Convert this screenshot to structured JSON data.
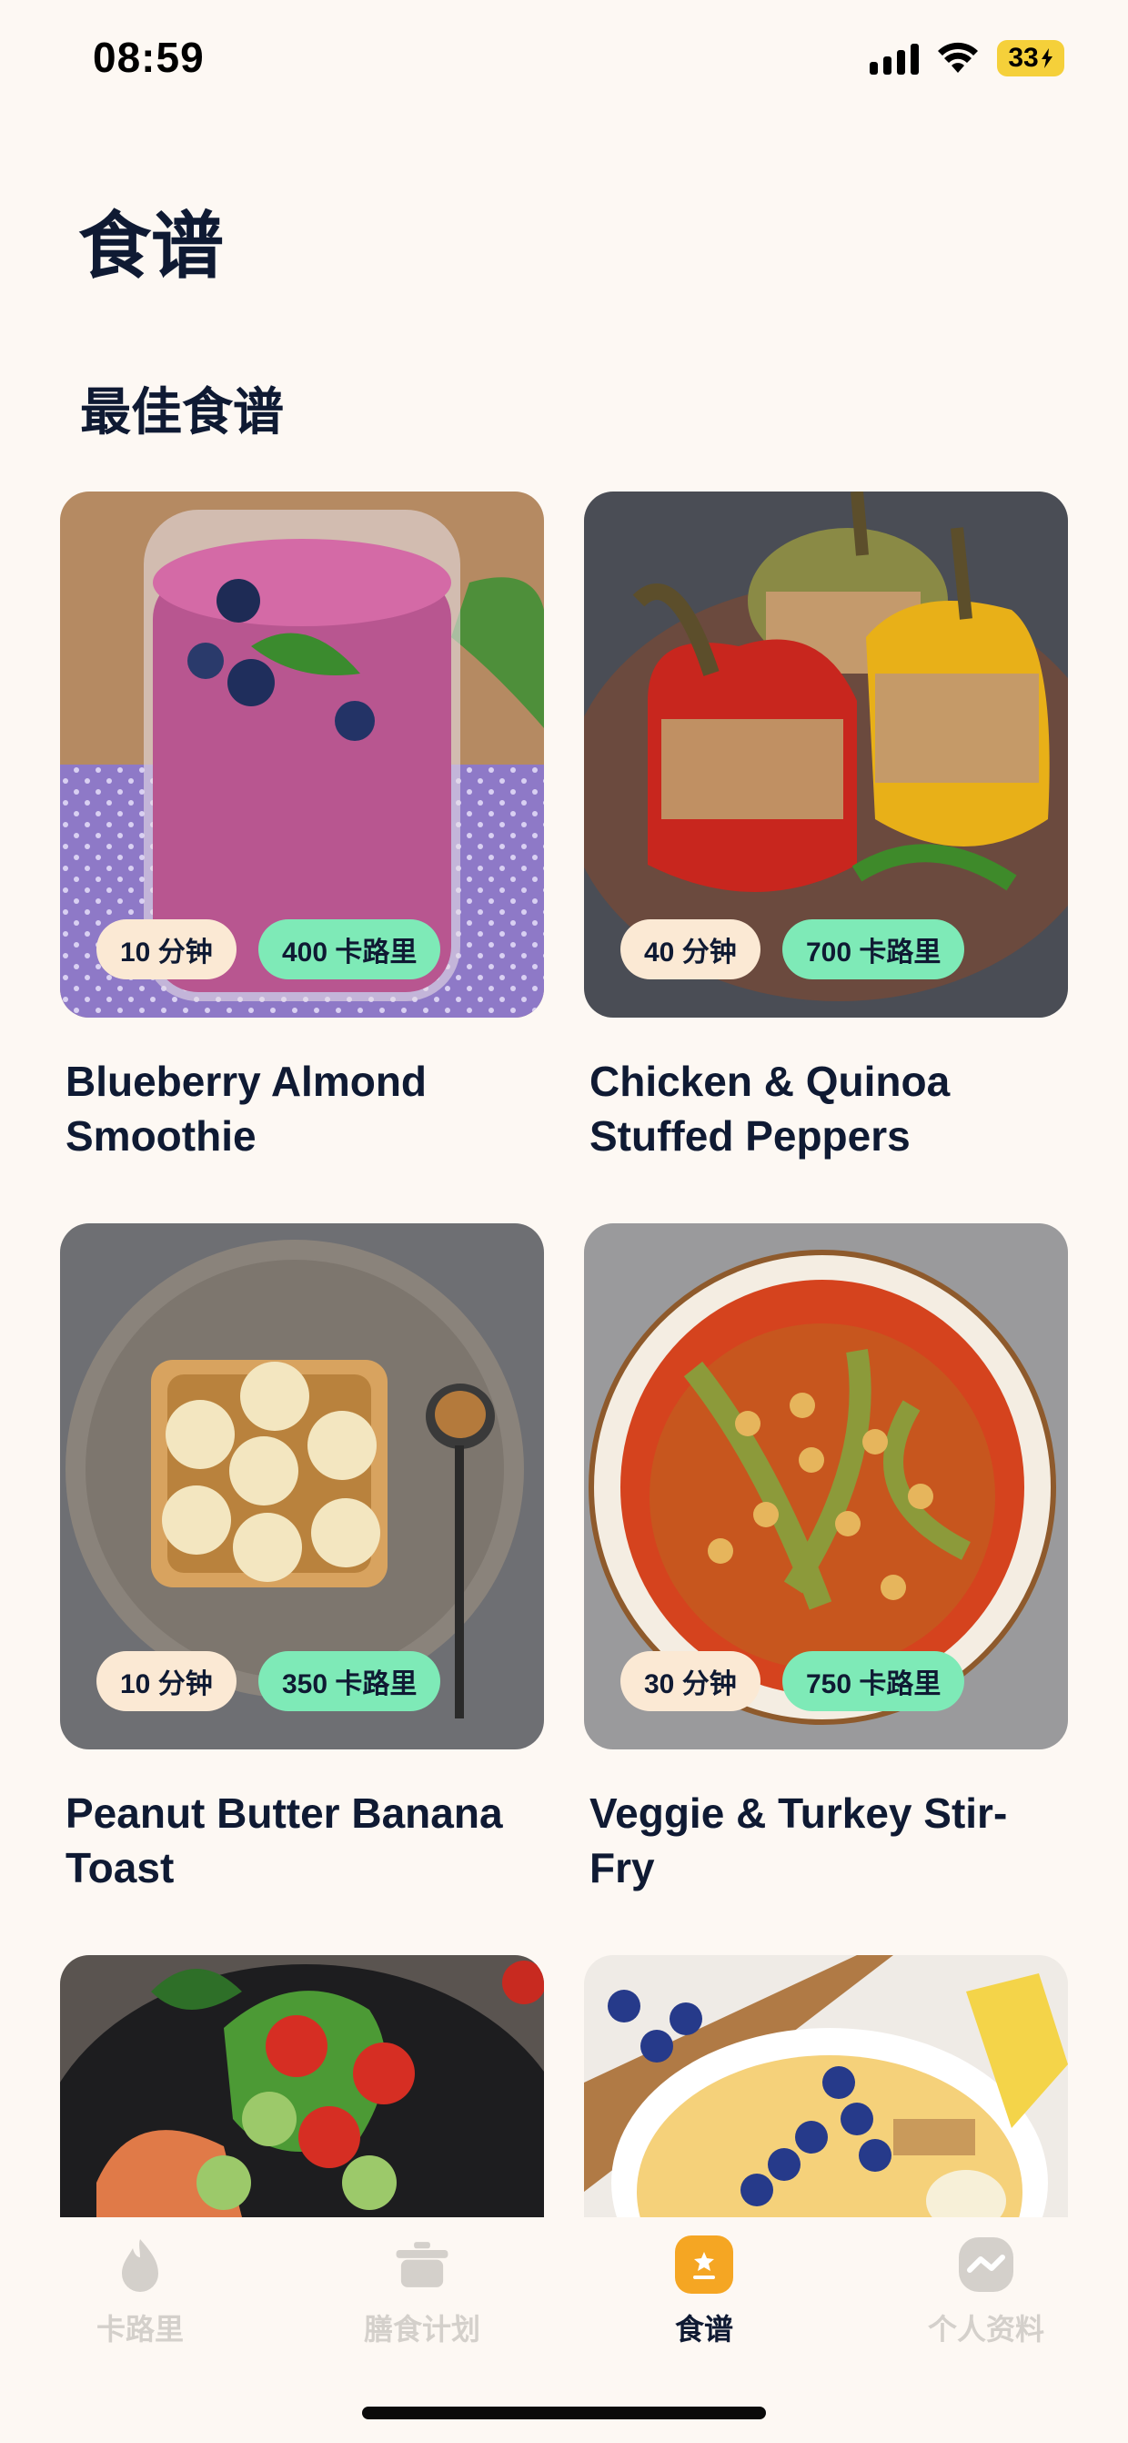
{
  "status": {
    "time": "08:59",
    "battery": "33"
  },
  "header": {
    "title": "食谱"
  },
  "section": {
    "title": "最佳食谱"
  },
  "recipes": [
    {
      "name": "Blueberry Almond Smoothie",
      "time": "10 分钟",
      "calories": "400 卡路里"
    },
    {
      "name": "Chicken & Quinoa Stuffed Peppers",
      "time": "40 分钟",
      "calories": "700 卡路里"
    },
    {
      "name": "Peanut Butter Banana Toast",
      "time": "10 分钟",
      "calories": "350 卡路里"
    },
    {
      "name": "Veggie & Turkey Stir-Fry",
      "time": "30 分钟",
      "calories": "750 卡路里"
    },
    {
      "name": "",
      "time": "",
      "calories": ""
    },
    {
      "name": "",
      "time": "",
      "calories": ""
    }
  ],
  "tabs": [
    {
      "label": "卡路里",
      "icon": "flame-icon"
    },
    {
      "label": "膳食计划",
      "icon": "pot-icon"
    },
    {
      "label": "食谱",
      "icon": "recipe-book-icon",
      "active": true
    },
    {
      "label": "个人资料",
      "icon": "profile-chart-icon"
    }
  ],
  "colors": {
    "background": "#FDF8F3",
    "time_chip": "#FBE9D4",
    "calorie_chip": "#7EEAB7",
    "active_tab": "#F5A623"
  }
}
